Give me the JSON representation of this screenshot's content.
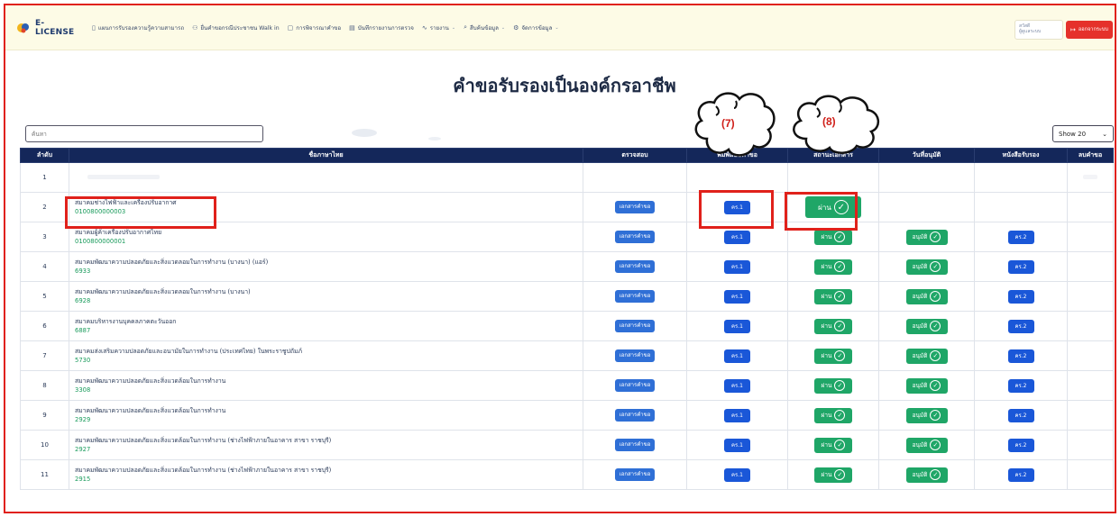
{
  "app": {
    "brand": "E-LICENSE"
  },
  "nav": {
    "items": [
      {
        "icon": "▯",
        "label": "แผนการรับรองความรู้ความสามารถ",
        "dropdown": false
      },
      {
        "icon": "⚇",
        "label": "ยื่นคำขอกรณีประชาชน Walk in",
        "dropdown": false
      },
      {
        "icon": "▢",
        "label": "การพิจารณาคำขอ",
        "dropdown": false
      },
      {
        "icon": "▤",
        "label": "บันทึกรายงานการตรวจ",
        "dropdown": false
      },
      {
        "icon": "∿",
        "label": "รายงาน",
        "dropdown": true
      },
      {
        "icon": "⌕",
        "label": "สืบค้นข้อมูล",
        "dropdown": true
      },
      {
        "icon": "⚙",
        "label": "จัดการข้อมูล",
        "dropdown": true
      }
    ],
    "user_line1": "สวัสดี",
    "user_line2": "ผู้ดูแลระบบ",
    "logout_label": "ออกจากระบบ"
  },
  "page": {
    "title": "คำขอรับรองเป็นองค์กรอาชีพ"
  },
  "search": {
    "placeholder": "ค้นหา"
  },
  "show": {
    "selected": "Show 20"
  },
  "table": {
    "headers": {
      "no": "ลำดับ",
      "name": "ชื่อภาษาไทย",
      "check": "ตรวจสอบ",
      "print": "พิมพ์แบบคำขอ",
      "doc_status": "สถานะเอกสาร",
      "approve_date": "วันที่อนุมัติ",
      "certificate": "หนังสือรับรอง",
      "delete": "ลบคำขอ"
    },
    "doc_button": "เอกสารคำขอ",
    "kr1": "คร.1",
    "kr2": "คร.2",
    "pass": "ผ่าน",
    "approved": "อนุมัติ",
    "rows": [
      {
        "no": "1",
        "name": "",
        "code": ""
      },
      {
        "no": "2",
        "name": "สมาคมช่างไฟฟ้าและเครื่องปรับอากาศ",
        "code": "0100800000003"
      },
      {
        "no": "3",
        "name": "สมาคมผู้ค้าเครื่องปรับอากาศไทย",
        "code": "0100800000001"
      },
      {
        "no": "4",
        "name": "สมาคมพัฒนาความปลอดภัยและสิ่งแวดลอมในการทำงาน (บางนา) (แอร์)",
        "code": "6933"
      },
      {
        "no": "5",
        "name": "สมาคมพัฒนาความปลอดภัยและสิ่งแวดลอมในการทำงาน (บางนา)",
        "code": "6928"
      },
      {
        "no": "6",
        "name": "สมาคมบริหารงานบุคคลภาคตะวันออก",
        "code": "6887"
      },
      {
        "no": "7",
        "name": "สมาคมส่งเสริมความปลอดภัยและอนามัยในการทำงาน (ประเทศไทย) ในพระราชูปถัมภ์",
        "code": "5730"
      },
      {
        "no": "8",
        "name": "สมาคมพัฒนาความปลอดภัยและสิ่งแวดล้อมในการทำงาน",
        "code": "3308"
      },
      {
        "no": "9",
        "name": "สมาคมพัฒนาความปลอดภัยและสิ่งแวดล้อมในการทำงาน",
        "code": "2929"
      },
      {
        "no": "10",
        "name": "สมาคมพัฒนาความปลอดภัยและสิ่งแวดล้อมในการทำงาน (ช่างไฟฟ้าภายในอาคาร สาขา ราชบุรี)",
        "code": "2927"
      },
      {
        "no": "11",
        "name": "สมาคมพัฒนาความปลอดภัยและสิ่งแวดล้อมในการทำงาน (ช่างไฟฟ้าภายในอาคาร สาขา ราชบุรี)",
        "code": "2915"
      }
    ]
  },
  "annotations": {
    "step7": "(7)",
    "step8": "(8)"
  },
  "colors": {
    "accent_red": "#e0211b",
    "header_navy": "#14275a",
    "pass_green": "#1fa667",
    "button_blue": "#1a57d8",
    "code_green": "#1a9b5c"
  }
}
